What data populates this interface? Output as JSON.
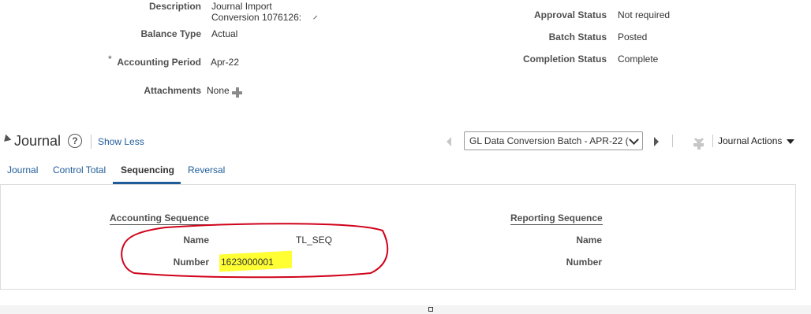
{
  "header": {
    "description_label": "Description",
    "description_value_line1": "Journal Import",
    "description_value_line2": "Conversion 1076126:",
    "balance_type_label": "Balance Type",
    "balance_type_value": "Actual",
    "required_marker": "*",
    "accounting_period_label": "Accounting Period",
    "accounting_period_value": "Apr-22",
    "attachments_label": "Attachments",
    "attachments_value": "None",
    "approval_status_label": "Approval Status",
    "approval_status_value": "Not required",
    "batch_status_label": "Batch Status",
    "batch_status_value": "Posted",
    "completion_status_label": "Completion Status",
    "completion_status_value": "Complete"
  },
  "journal": {
    "title": "Journal",
    "help_glyph": "?",
    "show_less": "Show Less",
    "batch_select": "GL Data Conversion Batch - APR-22 (",
    "actions_label": "Journal Actions"
  },
  "tabs": [
    {
      "label": "Journal"
    },
    {
      "label": "Control Total"
    },
    {
      "label": "Sequencing"
    },
    {
      "label": "Reversal"
    }
  ],
  "sequencing": {
    "accounting_heading": "Accounting Sequence",
    "reporting_heading": "Reporting Sequence",
    "name_label": "Name",
    "number_label": "Number",
    "accounting_name_value": "TL_SEQ",
    "accounting_number_value": "1623000001"
  },
  "colors": {
    "link": "#1f5c99",
    "annotation_circle": "#d0021b",
    "highlight": "#ffff33"
  },
  "icons": [
    "plus-icon",
    "help-icon",
    "previous-icon",
    "next-icon",
    "add-icon",
    "delete-icon",
    "dropdown-arrow-icon",
    "collapse-icon"
  ]
}
